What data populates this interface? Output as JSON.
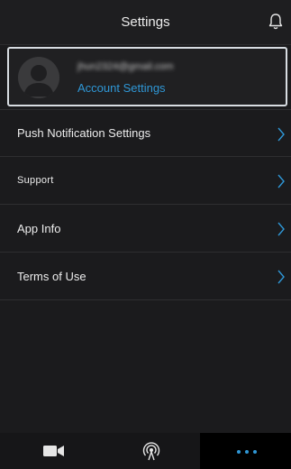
{
  "header": {
    "title": "Settings",
    "bell_icon": "bell-icon"
  },
  "account": {
    "avatar_icon": "user-avatar-icon",
    "email": "jhun2324@gmail.com",
    "link_label": "Account Settings"
  },
  "menu": {
    "items": [
      {
        "label": "Push Notification Settings",
        "chevron_icon": "chevron-right-icon"
      },
      {
        "label": "Support",
        "chevron_icon": "chevron-right-icon"
      },
      {
        "label": "App Info",
        "chevron_icon": "chevron-right-icon"
      },
      {
        "label": "Terms of Use",
        "chevron_icon": "chevron-right-icon"
      }
    ]
  },
  "tabbar": {
    "tabs": [
      {
        "icon": "video-camera-icon",
        "active": false
      },
      {
        "icon": "live-broadcast-icon",
        "active": false
      },
      {
        "icon": "more-dots-icon",
        "active": true
      }
    ]
  },
  "colors": {
    "accent": "#2f97d6",
    "background": "#1b1b1d",
    "active_tab": "#000000"
  }
}
